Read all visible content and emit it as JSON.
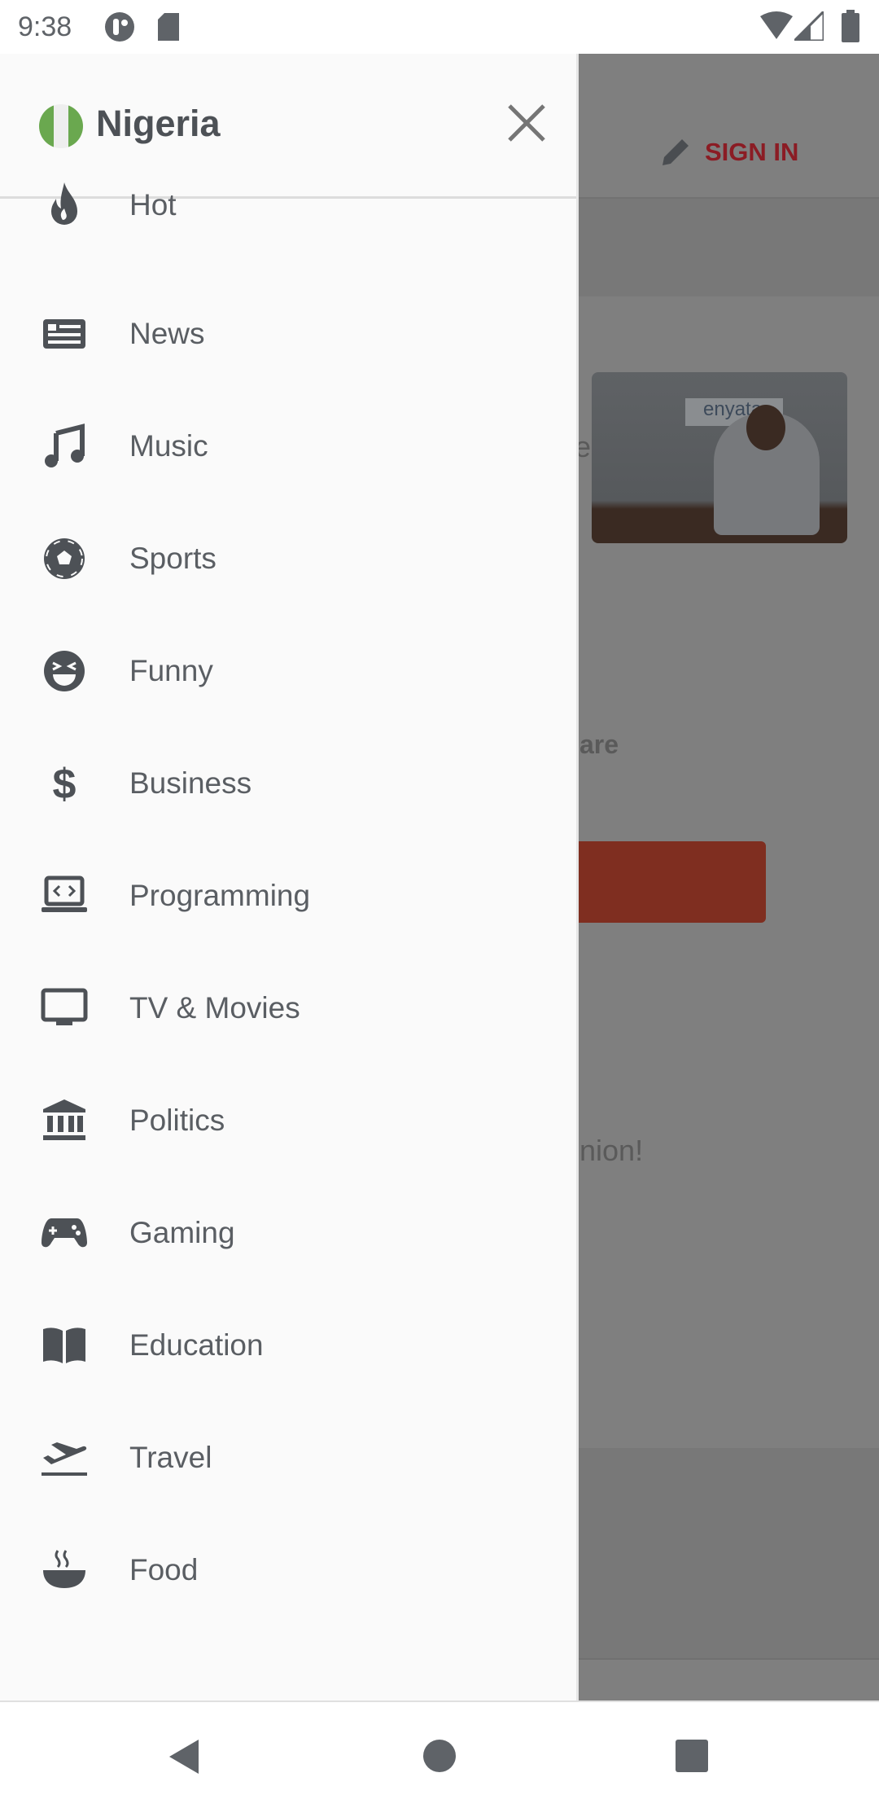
{
  "status_bar": {
    "time": "9:38"
  },
  "drawer": {
    "country": "Nigeria",
    "flag_colors": [
      "#6aa84f",
      "#eeeeee",
      "#6aa84f"
    ],
    "items": [
      {
        "label": "Hot",
        "icon": "fire-icon"
      },
      {
        "label": "News",
        "icon": "newspaper-icon"
      },
      {
        "label": "Music",
        "icon": "music-note-icon"
      },
      {
        "label": "Sports",
        "icon": "soccer-ball-icon"
      },
      {
        "label": "Funny",
        "icon": "laughing-face-icon"
      },
      {
        "label": "Business",
        "icon": "dollar-icon"
      },
      {
        "label": "Programming",
        "icon": "laptop-code-icon"
      },
      {
        "label": "TV & Movies",
        "icon": "tv-icon"
      },
      {
        "label": "Politics",
        "icon": "government-building-icon"
      },
      {
        "label": "Gaming",
        "icon": "gamepad-icon"
      },
      {
        "label": "Education",
        "icon": "book-icon"
      },
      {
        "label": "Travel",
        "icon": "airplane-takeoff-icon"
      },
      {
        "label": "Food",
        "icon": "bowl-icon"
      }
    ]
  },
  "background": {
    "sign_in": "SIGN IN",
    "photo_logo": "enyata",
    "fragments": [
      "e",
      "are",
      "nion!"
    ],
    "accent": "#c62828"
  }
}
